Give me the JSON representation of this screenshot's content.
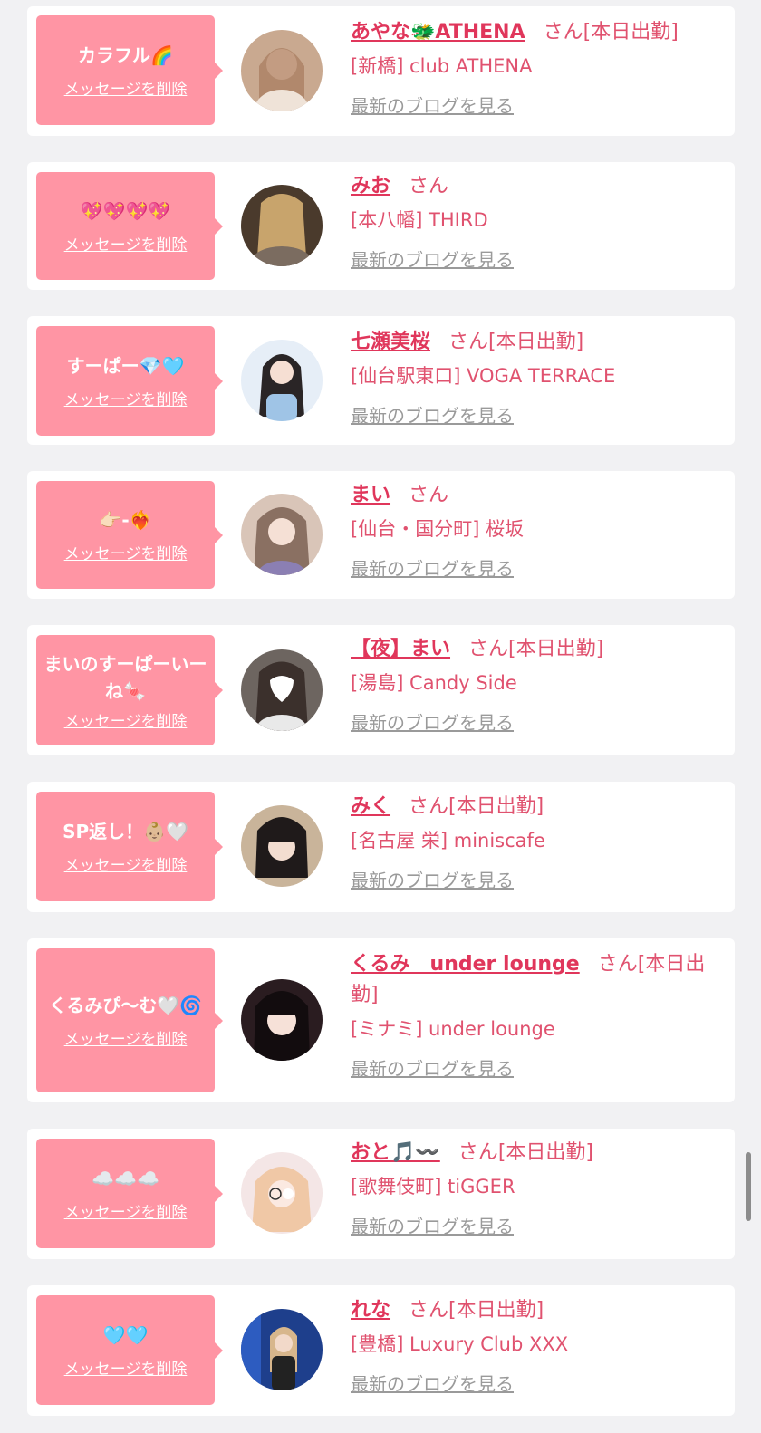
{
  "items": [
    {
      "message": "カラフル🌈",
      "delete_label": "メッセージを削除",
      "name": "あやな🐲ATHENA",
      "san": "さん",
      "status": "[本日出勤]",
      "shop": "[新橋] club ATHENA",
      "blog_label": "最新のブログを見る",
      "avatar_color": "#c9a990"
    },
    {
      "message": "💖💖💖💖",
      "delete_label": "メッセージを削除",
      "name": "みお",
      "san": "さん",
      "status": "",
      "shop": "[本八幡] THIRD",
      "blog_label": "最新のブログを見る",
      "avatar_color": "#6e5a44"
    },
    {
      "message": "すーぱー💎🩵",
      "delete_label": "メッセージを削除",
      "name": "七瀬美桜",
      "san": "さん",
      "status": "[本日出勤]",
      "shop": "[仙台駅東口] VOGA TERRACE",
      "blog_label": "最新のブログを見る",
      "avatar_color": "#d8e6f2"
    },
    {
      "message": "👉🏻-❤️‍🔥",
      "delete_label": "メッセージを削除",
      "name": "まい",
      "san": "さん",
      "status": "",
      "shop": "[仙台・国分町] 桜坂",
      "blog_label": "最新のブログを見る",
      "avatar_color": "#b89d8a"
    },
    {
      "message": "まいのすーぱーいーね🍬",
      "delete_label": "メッセージを削除",
      "name": "【夜】まい",
      "san": "さん",
      "status": "[本日出勤]",
      "shop": "[湯島] Candy Side",
      "blog_label": "最新のブログを見る",
      "avatar_color": "#7d7068"
    },
    {
      "message": "SP返し！👶🏼🤍",
      "delete_label": "メッセージを削除",
      "name": "みく",
      "san": "さん",
      "status": "[本日出勤]",
      "shop": "[名古屋 栄] miniscafe",
      "blog_label": "最新のブログを見る",
      "avatar_color": "#6b5848"
    },
    {
      "message": "くるみぴ〜む🤍🌀",
      "delete_label": "メッセージを削除",
      "name": "くるみ　under lounge",
      "san": "さん",
      "status": "[本日出勤]",
      "shop": "[ミナミ] under lounge",
      "blog_label": "最新のブログを見る",
      "avatar_color": "#3c2a2e"
    },
    {
      "message": "☁️☁️☁️",
      "delete_label": "メッセージを削除",
      "name": "おと🎵〰️",
      "san": "さん",
      "status": "[本日出勤]",
      "shop": "[歌舞伎町] tiGGER",
      "blog_label": "最新のブログを見る",
      "avatar_color": "#f1d7d6"
    },
    {
      "message": "🩵🩵",
      "delete_label": "メッセージを削除",
      "name": "れな",
      "san": "さん",
      "status": "[本日出勤]",
      "shop": "[豊橋] Luxury Club XXX",
      "blog_label": "最新のブログを見る",
      "avatar_color": "#1e3f8c"
    }
  ]
}
